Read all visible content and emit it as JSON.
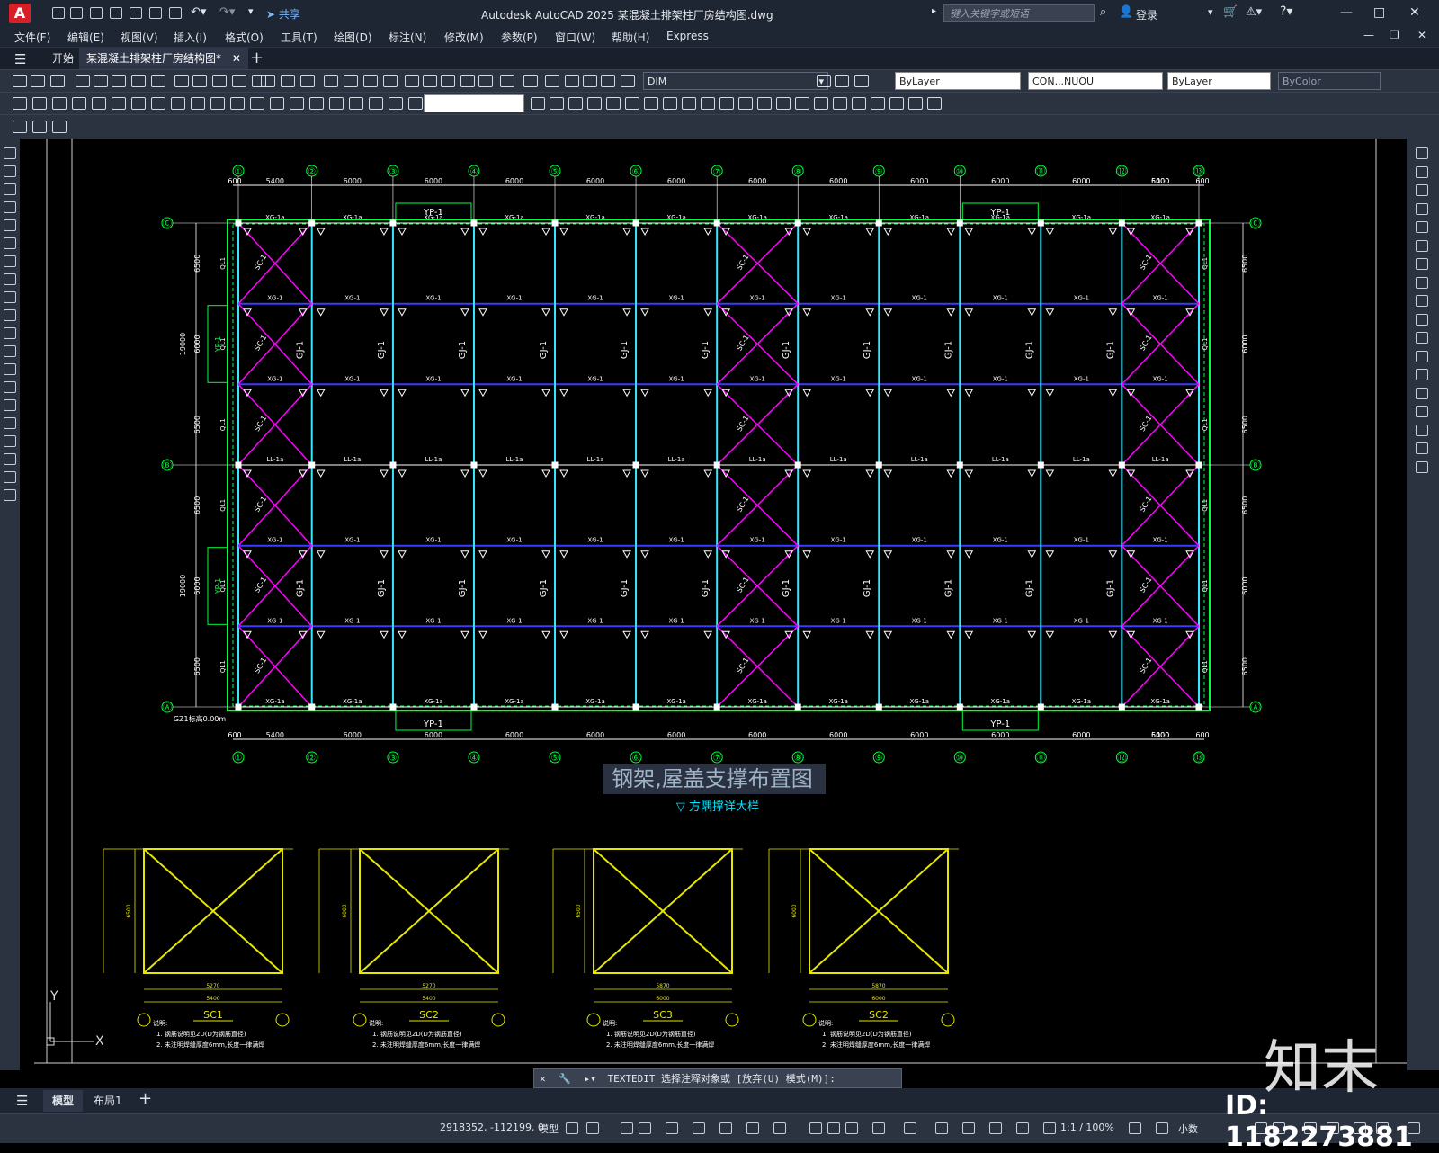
{
  "titlebar": {
    "logo": "A",
    "share": "共享",
    "title": "Autodesk AutoCAD 2025    某混凝土排架柱厂房结构图.dwg",
    "search_placeholder": "键入关键字或短语",
    "login": "登录",
    "minimize": "—",
    "maximize": "□",
    "close": "✕"
  },
  "menu": [
    "文件(F)",
    "编辑(E)",
    "视图(V)",
    "插入(I)",
    "格式(O)",
    "工具(T)",
    "绘图(D)",
    "标注(N)",
    "修改(M)",
    "参数(P)",
    "窗口(W)",
    "帮助(H)",
    "Express"
  ],
  "tabs": {
    "start": "开始",
    "doc": "某混凝土排架柱厂房结构图*",
    "close": "✕",
    "add": "+"
  },
  "toolbar": {
    "layer": "DIM",
    "color": "ByLayer",
    "linetype": "CON...NUOU",
    "lineweight": "ByLayer",
    "plotstyle": "ByColor",
    "dimstyle": ""
  },
  "drawing": {
    "title": "钢架,屋盖支撑布置图",
    "subtitle": "▽ 方隅撑详大样",
    "axes_top": [
      "①",
      "②",
      "③",
      "④",
      "⑤",
      "⑥",
      "⑦",
      "⑧",
      "⑨",
      "⑩",
      "⑪",
      "⑫",
      "⑬"
    ],
    "bay_dims": [
      "600",
      "5400",
      "6000",
      "6000",
      "6000",
      "6000",
      "6000",
      "6000",
      "6000",
      "6000",
      "6000",
      "6000",
      "6000",
      "5400",
      "600"
    ],
    "row_axes": [
      "Ⓒ",
      "Ⓑ",
      "Ⓐ"
    ],
    "side_dims": [
      "6500",
      "6000",
      "6500",
      "6500",
      "6000",
      "6500"
    ],
    "side_total": [
      "19000",
      "19000"
    ],
    "labels": {
      "gj": "GJ-1",
      "xg": "XG-1",
      "xg2": "XG-1a",
      "ll": "LL-1a",
      "sc": "SC-1",
      "yp": "YP-1",
      "qli": "QL1",
      "gz": "GZ1标高0.00m"
    },
    "details": [
      {
        "name": "SC1",
        "w": "5400",
        "w2": "5270",
        "h": "6500"
      },
      {
        "name": "SC2",
        "w": "5400",
        "w2": "5270",
        "h": "6000"
      },
      {
        "name": "SC3",
        "w": "6000",
        "w2": "5870",
        "h": "6500"
      },
      {
        "name": "SC2",
        "w": "6000",
        "w2": "5870",
        "h": "6000"
      }
    ],
    "notes_head": "说明:",
    "note1": "1. 钢筋说明见2D(D为钢筋直径)",
    "note2": "2. 未注明焊缝厚度6mm,长度一律满焊",
    "ucs_y": "Y",
    "ucs_x": "X"
  },
  "cmdline": {
    "text": "TEXTEDIT 选择注释对象或 [放弃(U) 模式(M)]:"
  },
  "layout_tabs": [
    "模型",
    "布局1"
  ],
  "status": {
    "coords": "2918352, -112199, 0",
    "mode": "模型",
    "scale": "1:1 / 100%",
    "units": "小数"
  },
  "watermark": {
    "logo": "知末",
    "id": "ID: 1182273881"
  }
}
